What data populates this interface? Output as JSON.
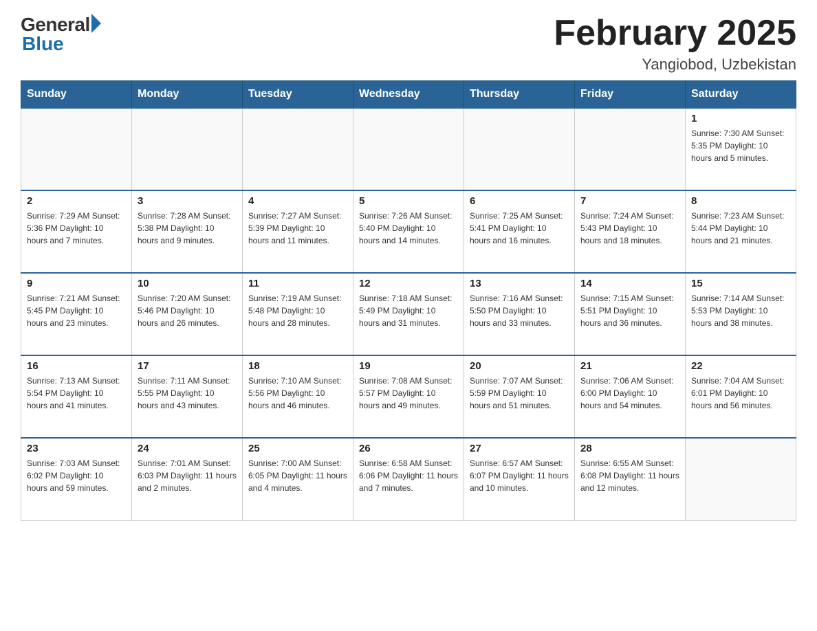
{
  "header": {
    "logo_general": "General",
    "logo_blue": "Blue",
    "title": "February 2025",
    "location": "Yangiobod, Uzbekistan"
  },
  "days_of_week": [
    "Sunday",
    "Monday",
    "Tuesday",
    "Wednesday",
    "Thursday",
    "Friday",
    "Saturday"
  ],
  "weeks": [
    [
      {
        "day": "",
        "info": ""
      },
      {
        "day": "",
        "info": ""
      },
      {
        "day": "",
        "info": ""
      },
      {
        "day": "",
        "info": ""
      },
      {
        "day": "",
        "info": ""
      },
      {
        "day": "",
        "info": ""
      },
      {
        "day": "1",
        "info": "Sunrise: 7:30 AM\nSunset: 5:35 PM\nDaylight: 10 hours and 5 minutes."
      }
    ],
    [
      {
        "day": "2",
        "info": "Sunrise: 7:29 AM\nSunset: 5:36 PM\nDaylight: 10 hours and 7 minutes."
      },
      {
        "day": "3",
        "info": "Sunrise: 7:28 AM\nSunset: 5:38 PM\nDaylight: 10 hours and 9 minutes."
      },
      {
        "day": "4",
        "info": "Sunrise: 7:27 AM\nSunset: 5:39 PM\nDaylight: 10 hours and 11 minutes."
      },
      {
        "day": "5",
        "info": "Sunrise: 7:26 AM\nSunset: 5:40 PM\nDaylight: 10 hours and 14 minutes."
      },
      {
        "day": "6",
        "info": "Sunrise: 7:25 AM\nSunset: 5:41 PM\nDaylight: 10 hours and 16 minutes."
      },
      {
        "day": "7",
        "info": "Sunrise: 7:24 AM\nSunset: 5:43 PM\nDaylight: 10 hours and 18 minutes."
      },
      {
        "day": "8",
        "info": "Sunrise: 7:23 AM\nSunset: 5:44 PM\nDaylight: 10 hours and 21 minutes."
      }
    ],
    [
      {
        "day": "9",
        "info": "Sunrise: 7:21 AM\nSunset: 5:45 PM\nDaylight: 10 hours and 23 minutes."
      },
      {
        "day": "10",
        "info": "Sunrise: 7:20 AM\nSunset: 5:46 PM\nDaylight: 10 hours and 26 minutes."
      },
      {
        "day": "11",
        "info": "Sunrise: 7:19 AM\nSunset: 5:48 PM\nDaylight: 10 hours and 28 minutes."
      },
      {
        "day": "12",
        "info": "Sunrise: 7:18 AM\nSunset: 5:49 PM\nDaylight: 10 hours and 31 minutes."
      },
      {
        "day": "13",
        "info": "Sunrise: 7:16 AM\nSunset: 5:50 PM\nDaylight: 10 hours and 33 minutes."
      },
      {
        "day": "14",
        "info": "Sunrise: 7:15 AM\nSunset: 5:51 PM\nDaylight: 10 hours and 36 minutes."
      },
      {
        "day": "15",
        "info": "Sunrise: 7:14 AM\nSunset: 5:53 PM\nDaylight: 10 hours and 38 minutes."
      }
    ],
    [
      {
        "day": "16",
        "info": "Sunrise: 7:13 AM\nSunset: 5:54 PM\nDaylight: 10 hours and 41 minutes."
      },
      {
        "day": "17",
        "info": "Sunrise: 7:11 AM\nSunset: 5:55 PM\nDaylight: 10 hours and 43 minutes."
      },
      {
        "day": "18",
        "info": "Sunrise: 7:10 AM\nSunset: 5:56 PM\nDaylight: 10 hours and 46 minutes."
      },
      {
        "day": "19",
        "info": "Sunrise: 7:08 AM\nSunset: 5:57 PM\nDaylight: 10 hours and 49 minutes."
      },
      {
        "day": "20",
        "info": "Sunrise: 7:07 AM\nSunset: 5:59 PM\nDaylight: 10 hours and 51 minutes."
      },
      {
        "day": "21",
        "info": "Sunrise: 7:06 AM\nSunset: 6:00 PM\nDaylight: 10 hours and 54 minutes."
      },
      {
        "day": "22",
        "info": "Sunrise: 7:04 AM\nSunset: 6:01 PM\nDaylight: 10 hours and 56 minutes."
      }
    ],
    [
      {
        "day": "23",
        "info": "Sunrise: 7:03 AM\nSunset: 6:02 PM\nDaylight: 10 hours and 59 minutes."
      },
      {
        "day": "24",
        "info": "Sunrise: 7:01 AM\nSunset: 6:03 PM\nDaylight: 11 hours and 2 minutes."
      },
      {
        "day": "25",
        "info": "Sunrise: 7:00 AM\nSunset: 6:05 PM\nDaylight: 11 hours and 4 minutes."
      },
      {
        "day": "26",
        "info": "Sunrise: 6:58 AM\nSunset: 6:06 PM\nDaylight: 11 hours and 7 minutes."
      },
      {
        "day": "27",
        "info": "Sunrise: 6:57 AM\nSunset: 6:07 PM\nDaylight: 11 hours and 10 minutes."
      },
      {
        "day": "28",
        "info": "Sunrise: 6:55 AM\nSunset: 6:08 PM\nDaylight: 11 hours and 12 minutes."
      },
      {
        "day": "",
        "info": ""
      }
    ]
  ]
}
